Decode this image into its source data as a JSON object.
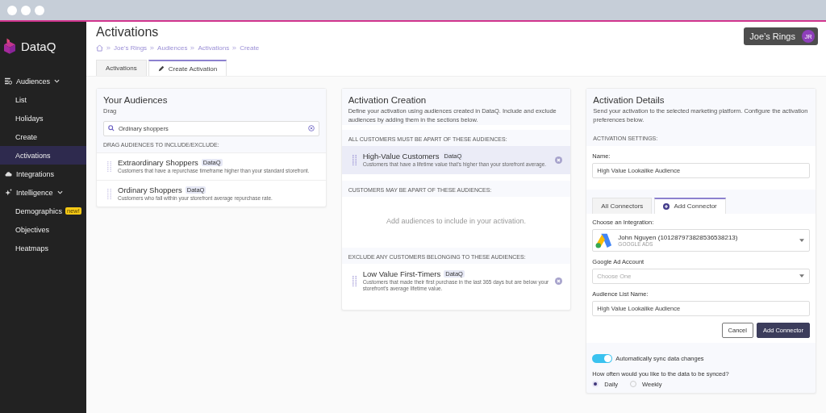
{
  "sidebar": {
    "logo": "DataQ",
    "items": [
      {
        "label": "Audiences",
        "expanded": true,
        "children": [
          {
            "label": "List",
            "selected": false
          },
          {
            "label": "Holidays",
            "selected": false
          },
          {
            "label": "Create",
            "selected": false
          },
          {
            "label": "Activations",
            "selected": true
          }
        ]
      },
      {
        "label": "Integrations"
      },
      {
        "label": "Intelligence",
        "expanded": true,
        "children": [
          {
            "label": "Demographics",
            "badge": "new!",
            "selected": false
          },
          {
            "label": "Objectives",
            "selected": false
          },
          {
            "label": "Heatmaps",
            "selected": false
          }
        ]
      }
    ]
  },
  "header": {
    "title": "Activations",
    "breadcrumbs": [
      "Joe's Rings",
      "Audiences",
      "Activations",
      "Create"
    ],
    "account": {
      "name": "Joe’s Rings",
      "initials": "JR"
    }
  },
  "tabs": [
    {
      "label": "Activations",
      "selected": false
    },
    {
      "label": "Create Activation",
      "selected": true
    }
  ],
  "your_audiences": {
    "title": "Your Audiences",
    "subtitle": "Drag",
    "search": {
      "value": "Ordinary shoppers"
    },
    "section_label": "DRAG AUDIENCES TO INCLUDE/EXCLUDE:",
    "audiences": [
      {
        "name": "Extraordinary Shoppers",
        "tag": "DataQ",
        "description": "Customers that have a repurchase timeframe higher than your standard storefront."
      },
      {
        "name": "Ordinary Shoppers",
        "tag": "DataQ",
        "description": "Customers who fall within your storefront average repurchase rate."
      }
    ]
  },
  "activation_creation": {
    "title": "Activation Creation",
    "description": "Define your activation using audiences created in DataQ. Include and exclude audiences by adding them in the sections below.",
    "sections": [
      {
        "label": "ALL CUSTOMERS MUST BE APART OF THESE AUDIENCES:",
        "audiences": [
          {
            "name": "High-Value Customers",
            "tag": "DataQ",
            "description": "Customers that have a lifetime value that's higher than your storefront average.",
            "selected": true
          }
        ]
      },
      {
        "label": "CUSTOMERS MAY BE APART OF THESE AUDIENCES:",
        "empty_text": "Add audiences to include in your activation."
      },
      {
        "label": "EXCLUDE ANY CUSTOMERS BELONGING TO THESE AUDIENCES:",
        "audiences": [
          {
            "name": "Low Value First-Timers",
            "tag": "DataQ",
            "description": "Customers that made their first purchase in the last 365 days but are below your storefront's average lifetime value.",
            "selected": false
          }
        ]
      }
    ]
  },
  "activation_details": {
    "title": "Activation Details",
    "description": "Send your activation to the selected marketing platform. Configure the activation preferences below.",
    "section_label": "ACTIVATION SETTINGS:",
    "name_label": "Name:",
    "name_value": "High Value Lookalike Audience",
    "connector_tabs": [
      {
        "label": "All Connectors",
        "selected": false
      },
      {
        "label": "Add Connector",
        "selected": true
      }
    ],
    "integration_label": "Choose an Integration:",
    "integration": {
      "name": "John Nguyen (101287973828536538213)",
      "type": "GOOGLE ADS"
    },
    "ad_account_label": "Google Ad Account",
    "ad_account_placeholder": "Choose One",
    "list_name_label": "Audience List Name:",
    "list_name_value": "High Value Lookalike Audience",
    "buttons": [
      {
        "label": "Cancel",
        "kind": "secondary"
      },
      {
        "label": "Add Connector",
        "kind": "primary"
      }
    ],
    "sync": {
      "label": "Automatically sync data changes",
      "on": true
    },
    "frequency_question": "How often would you like to the data to be synced?",
    "frequency_options": [
      {
        "label": "Daily",
        "selected": true
      },
      {
        "label": "Weekly",
        "selected": false
      }
    ]
  }
}
